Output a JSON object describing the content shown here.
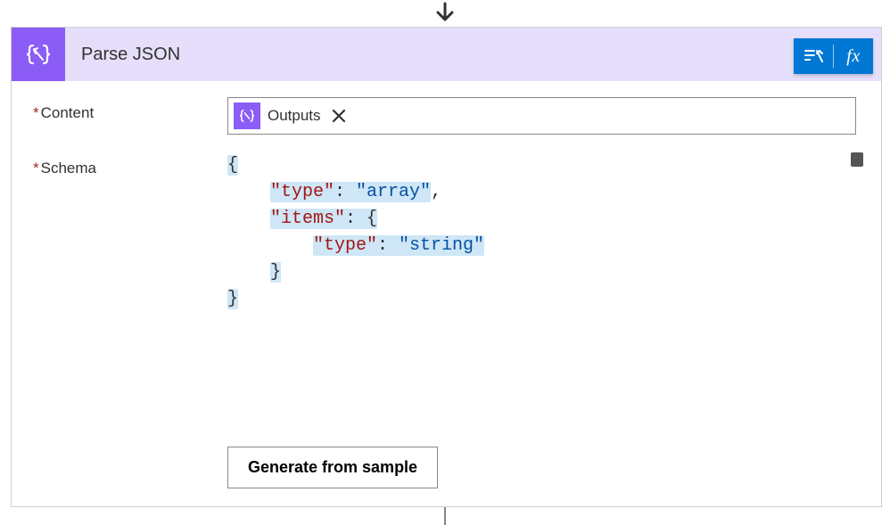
{
  "header": {
    "title": "Parse JSON"
  },
  "fields": {
    "content": {
      "label": "Content",
      "token_label": "Outputs"
    },
    "schema": {
      "label": "Schema",
      "json": {
        "open": "{",
        "line1_key": "\"type\"",
        "line1_colon": ": ",
        "line1_val": "\"array\"",
        "line1_comma": ",",
        "line2_key": "\"items\"",
        "line2_colon": ": ",
        "line2_open": "{",
        "line3_key": "\"type\"",
        "line3_colon": ": ",
        "line3_val": "\"string\"",
        "line4_close": "}",
        "close": "}"
      }
    }
  },
  "buttons": {
    "generate": "Generate from sample"
  },
  "actions": {
    "fx": "fx"
  }
}
